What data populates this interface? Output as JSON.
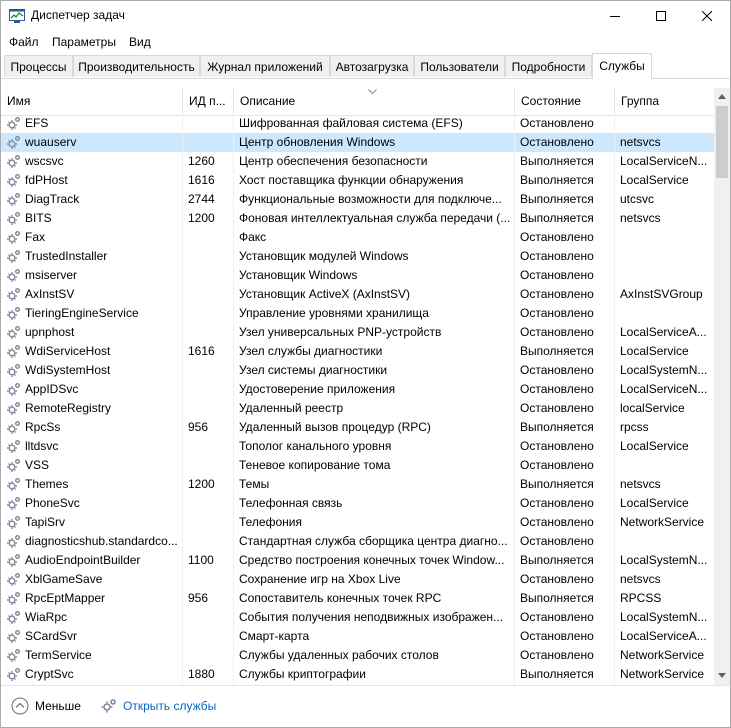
{
  "window": {
    "title": "Диспетчер задач"
  },
  "menu": [
    "Файл",
    "Параметры",
    "Вид"
  ],
  "tabs": [
    {
      "label": "Процессы",
      "active": false
    },
    {
      "label": "Производительность",
      "active": false
    },
    {
      "label": "Журнал приложений",
      "active": false
    },
    {
      "label": "Автозагрузка",
      "active": false
    },
    {
      "label": "Пользователи",
      "active": false
    },
    {
      "label": "Подробности",
      "active": false
    },
    {
      "label": "Службы",
      "active": true
    }
  ],
  "columns": [
    "Имя",
    "ИД п...",
    "Описание",
    "Состояние",
    "Группа"
  ],
  "rows": [
    {
      "name": "EFS",
      "pid": "",
      "desc": "Шифрованная файловая система (EFS)",
      "state": "Остановлено",
      "group": ""
    },
    {
      "name": "wuauserv",
      "pid": "",
      "desc": "Центр обновления Windows",
      "state": "Остановлено",
      "group": "netsvcs",
      "selected": true
    },
    {
      "name": "wscsvc",
      "pid": "1260",
      "desc": "Центр обеспечения безопасности",
      "state": "Выполняется",
      "group": "LocalServiceN..."
    },
    {
      "name": "fdPHost",
      "pid": "1616",
      "desc": "Хост поставщика функции обнаружения",
      "state": "Выполняется",
      "group": "LocalService"
    },
    {
      "name": "DiagTrack",
      "pid": "2744",
      "desc": "Функциональные возможности для подключе...",
      "state": "Выполняется",
      "group": "utcsvc"
    },
    {
      "name": "BITS",
      "pid": "1200",
      "desc": "Фоновая интеллектуальная служба передачи (...",
      "state": "Выполняется",
      "group": "netsvcs"
    },
    {
      "name": "Fax",
      "pid": "",
      "desc": "Факс",
      "state": "Остановлено",
      "group": ""
    },
    {
      "name": "TrustedInstaller",
      "pid": "",
      "desc": "Установщик модулей Windows",
      "state": "Остановлено",
      "group": ""
    },
    {
      "name": "msiserver",
      "pid": "",
      "desc": "Установщик Windows",
      "state": "Остановлено",
      "group": ""
    },
    {
      "name": "AxInstSV",
      "pid": "",
      "desc": "Установщик ActiveX (AxInstSV)",
      "state": "Остановлено",
      "group": "AxInstSVGroup"
    },
    {
      "name": "TieringEngineService",
      "pid": "",
      "desc": "Управление уровнями хранилища",
      "state": "Остановлено",
      "group": ""
    },
    {
      "name": "upnphost",
      "pid": "",
      "desc": "Узел универсальных PNP-устройств",
      "state": "Остановлено",
      "group": "LocalServiceA..."
    },
    {
      "name": "WdiServiceHost",
      "pid": "1616",
      "desc": "Узел службы диагностики",
      "state": "Выполняется",
      "group": "LocalService"
    },
    {
      "name": "WdiSystemHost",
      "pid": "",
      "desc": "Узел системы диагностики",
      "state": "Остановлено",
      "group": "LocalSystemN..."
    },
    {
      "name": "AppIDSvc",
      "pid": "",
      "desc": "Удостоверение приложения",
      "state": "Остановлено",
      "group": "LocalServiceN..."
    },
    {
      "name": "RemoteRegistry",
      "pid": "",
      "desc": "Удаленный реестр",
      "state": "Остановлено",
      "group": "localService"
    },
    {
      "name": "RpcSs",
      "pid": "956",
      "desc": "Удаленный вызов процедур (RPC)",
      "state": "Выполняется",
      "group": "rpcss"
    },
    {
      "name": "lltdsvc",
      "pid": "",
      "desc": "Тополог канального уровня",
      "state": "Остановлено",
      "group": "LocalService"
    },
    {
      "name": "VSS",
      "pid": "",
      "desc": "Теневое копирование тома",
      "state": "Остановлено",
      "group": ""
    },
    {
      "name": "Themes",
      "pid": "1200",
      "desc": "Темы",
      "state": "Выполняется",
      "group": "netsvcs"
    },
    {
      "name": "PhoneSvc",
      "pid": "",
      "desc": "Телефонная связь",
      "state": "Остановлено",
      "group": "LocalService"
    },
    {
      "name": "TapiSrv",
      "pid": "",
      "desc": "Телефония",
      "state": "Остановлено",
      "group": "NetworkService"
    },
    {
      "name": "diagnosticshub.standardco...",
      "pid": "",
      "desc": "Стандартная служба сборщика центра диагно...",
      "state": "Остановлено",
      "group": ""
    },
    {
      "name": "AudioEndpointBuilder",
      "pid": "1100",
      "desc": "Средство построения конечных точек Window...",
      "state": "Выполняется",
      "group": "LocalSystemN..."
    },
    {
      "name": "XblGameSave",
      "pid": "",
      "desc": "Сохранение игр на Xbox Live",
      "state": "Остановлено",
      "group": "netsvcs"
    },
    {
      "name": "RpcEptMapper",
      "pid": "956",
      "desc": "Сопоставитель конечных точек RPC",
      "state": "Выполняется",
      "group": "RPCSS"
    },
    {
      "name": "WiaRpc",
      "pid": "",
      "desc": "События получения неподвижных изображен...",
      "state": "Остановлено",
      "group": "LocalSystemN..."
    },
    {
      "name": "SCardSvr",
      "pid": "",
      "desc": "Смарт-карта",
      "state": "Остановлено",
      "group": "LocalServiceA..."
    },
    {
      "name": "TermService",
      "pid": "",
      "desc": "Службы удаленных рабочих столов",
      "state": "Остановлено",
      "group": "NetworkService"
    },
    {
      "name": "CryptSvc",
      "pid": "1880",
      "desc": "Службы криптографии",
      "state": "Выполняется",
      "group": "NetworkService"
    }
  ],
  "footer": {
    "fewer_label": "Меньше",
    "open_services_label": "Открыть службы"
  },
  "colors": {
    "selected_row": "#cce8ff",
    "link": "#0066cc",
    "accent": "#0078d7"
  }
}
